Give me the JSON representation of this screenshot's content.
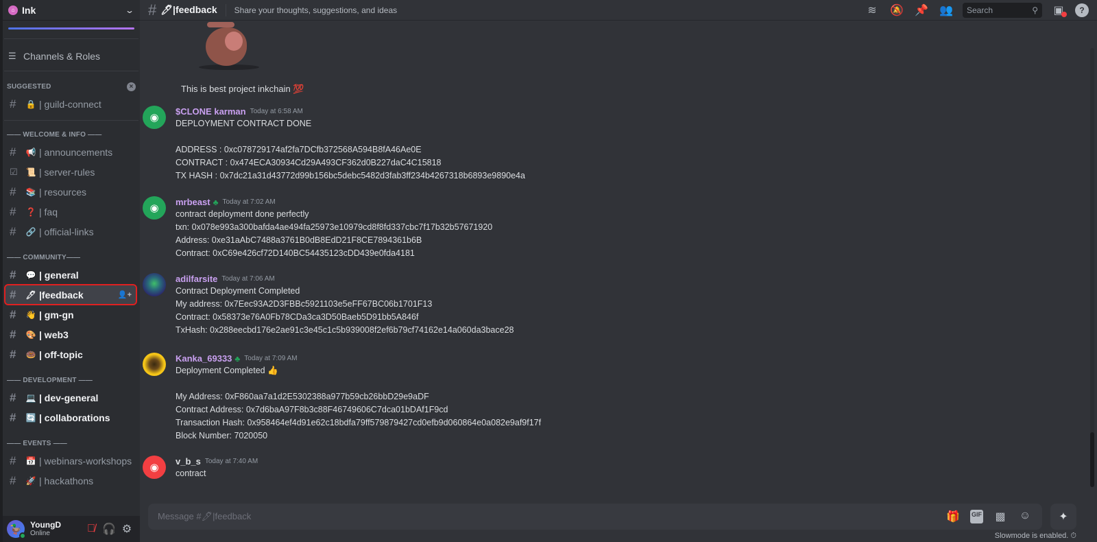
{
  "server": {
    "name": "Ink",
    "icon": "house-icon"
  },
  "sidebar": {
    "channels_roles_label": "Channels & Roles",
    "suggested": {
      "label": "SUGGESTED",
      "channels": [
        {
          "emoji": "🔒",
          "name": "| guild-connect"
        }
      ]
    },
    "categories": [
      {
        "label": "—— WELCOME & INFO ——",
        "channels": [
          {
            "emoji": "📢",
            "name": "| announcements",
            "unread": false,
            "icon": "hash"
          },
          {
            "emoji": "📜",
            "name": "| server-rules",
            "unread": false,
            "icon": "rules"
          },
          {
            "emoji": "📚",
            "name": "| resources",
            "unread": false,
            "icon": "hash"
          },
          {
            "emoji": "❓",
            "name": "| faq",
            "unread": false,
            "icon": "hash"
          },
          {
            "emoji": "🔗",
            "name": "| official-links",
            "unread": false,
            "icon": "hash"
          }
        ]
      },
      {
        "label": "—— COMMUNITY——",
        "channels": [
          {
            "emoji": "💬",
            "name": "| general",
            "unread": true
          },
          {
            "emoji": "🖊",
            "name": "|feedback",
            "active": true
          },
          {
            "emoji": "👋",
            "name": "| gm-gn",
            "unread": true
          },
          {
            "emoji": "🎨",
            "name": "| web3",
            "unread": true
          },
          {
            "emoji": "🍩",
            "name": "| off-topic",
            "unread": true
          }
        ]
      },
      {
        "label": "—— DEVELOPMENT ——",
        "channels": [
          {
            "emoji": "💻",
            "name": "| dev-general",
            "unread": true
          },
          {
            "emoji": "🔄",
            "name": "| collaborations",
            "unread": true
          }
        ]
      },
      {
        "label": "—— EVENTS ——",
        "channels": [
          {
            "emoji": "📅",
            "name": "| webinars-workshops",
            "unread": false
          },
          {
            "emoji": "🚀",
            "name": "| hackathons",
            "unread": false
          }
        ]
      }
    ],
    "user": {
      "name": "YoungD",
      "status": "Online"
    }
  },
  "header": {
    "channel_name": "🖊|feedback",
    "topic": "Share your thoughts, suggestions, and ideas",
    "search_placeholder": "Search"
  },
  "messages": {
    "top_text": "This is best project inkchain 💯",
    "items": [
      {
        "author": "$CLONE karman",
        "timestamp": "Today at 6:58 AM",
        "badge": false,
        "lines": [
          "DEPLOYMENT CONTRACT DONE",
          "",
          "ADDRESS : 0xc078729174af2fa7DCfb372568A594B8fA46Ae0E",
          "CONTRACT : 0x474ECA30934Cd29A493CF362d0B227daC4C15818",
          "TX HASH : 0x7dc21a31d43772d99b156bc5debc5482d3fab3ff234b4267318b6893e9890e4a"
        ]
      },
      {
        "author": "mrbeast",
        "timestamp": "Today at 7:02 AM",
        "badge": true,
        "lines": [
          "contract deployment done perfectly",
          "txn: 0x078e993a300bafda4ae494fa25973e10979cd8f8fd337cbc7f17b32b57671920",
          "Address: 0xe31aAbC7488a3761B0dB8EdD21F8CE7894361b6B",
          "Contract: 0xC69e426cf72D140BC54435123cDD439e0fda4181"
        ]
      },
      {
        "author": "adilfarsite",
        "timestamp": "Today at 7:06 AM",
        "badge": false,
        "lines": [
          "Contract Deployment Completed",
          "My address: 0x7Eec93A2D3FBBc5921103e5eFF67BC06b1701F13",
          "Contract: 0x58373e76A0Fb78CDa3ca3D50Baeb5D91bb5A846f",
          "TxHash: 0x288eecbd176e2ae91c3e45c1c5b939008f2ef6b79cf74162e14a060da3bace28"
        ]
      },
      {
        "author": "Kanka_69333",
        "timestamp": "Today at 7:09 AM",
        "badge": true,
        "lines": [
          "Deployment Completed 👍",
          "",
          "My Address: 0xF860aa7a1d2E5302388a977b59cb26bbD29e9aDF",
          "Contract Address: 0x7d6baA97F8b3c88F46749606C7dca01bDAf1F9cd",
          "Transaction Hash: 0x958464ef4d91e62c18bdfa79ff579879427cd0efb9d060864e0a082e9af9f17f",
          "Block Number: 7020050"
        ]
      },
      {
        "author": "v_b_s",
        "timestamp": "Today at 7:40 AM",
        "badge": false,
        "lines": [
          "contract"
        ]
      }
    ]
  },
  "composer": {
    "placeholder": "Message #🖊|feedback",
    "gif_label": "GIF",
    "slowmode_text": "Slowmode is enabled. ⏱"
  },
  "colors": {
    "accent": "#5865f2",
    "username": "#c9a0f0",
    "online": "#23a55a",
    "highlight_outline": "#e02020"
  }
}
